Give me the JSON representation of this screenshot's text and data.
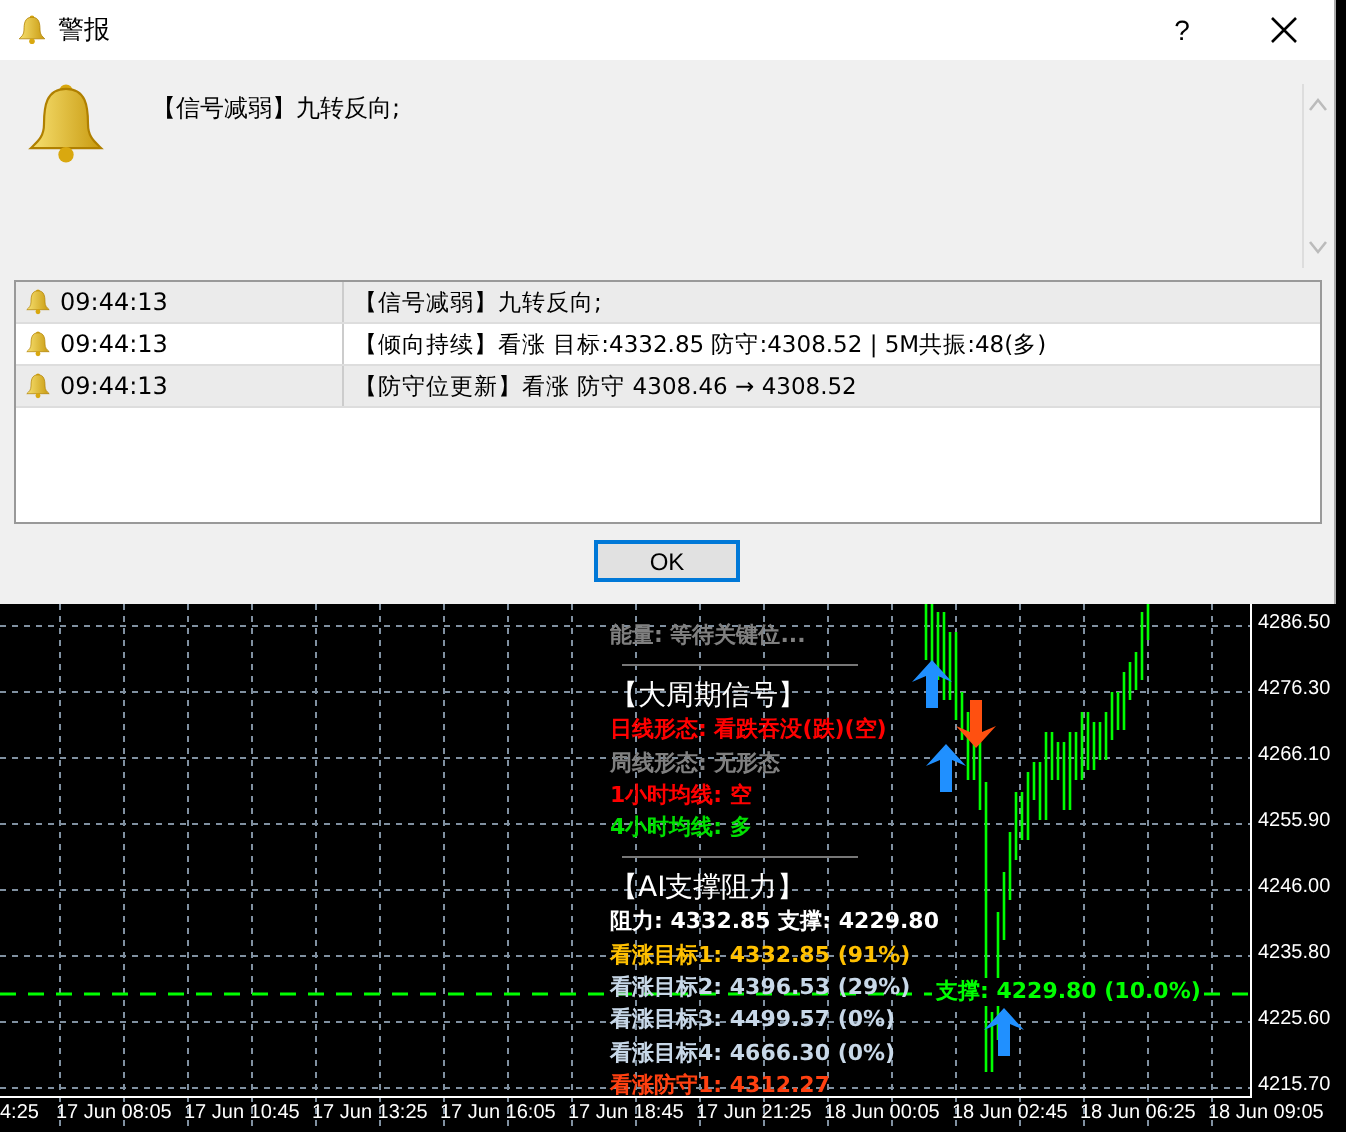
{
  "window": {
    "title": "警报",
    "help": "?"
  },
  "message": "【信号减弱】九转反向;",
  "alerts": [
    {
      "time": "09:44:13",
      "text": "【信号减弱】九转反向;"
    },
    {
      "time": "09:44:13",
      "text": "【倾向持续】看涨 目标:4332.85 防守:4308.52 | 5M共振:48(多)"
    },
    {
      "time": "09:44:13",
      "text": "【防守位更新】看涨 防守 4308.46 → 4308.52"
    }
  ],
  "ok_button": "OK",
  "chart": {
    "price_labels": [
      "4286.50",
      "4276.30",
      "4266.10",
      "4255.90",
      "4246.00",
      "4235.80",
      "4225.60",
      "4215.70"
    ],
    "time_labels": [
      "4:25",
      "17 Jun 08:05",
      "17 Jun 10:45",
      "17 Jun 13:25",
      "17 Jun 16:05",
      "17 Jun 18:45",
      "17 Jun 21:25",
      "18 Jun 00:05",
      "18 Jun 02:45",
      "18 Jun 06:25",
      "18 Jun 09:05"
    ],
    "overlay_lines": [
      {
        "kind": "line",
        "text": "能量: 等待关键位...",
        "color": "#808080"
      },
      {
        "kind": "divider"
      },
      {
        "kind": "heading",
        "text": "【大周期信号】",
        "color": "#ffffff"
      },
      {
        "kind": "line",
        "text": "日线形态: 看跌吞没(跌)(空)",
        "color": "#ff0000"
      },
      {
        "kind": "line",
        "text": "周线形态: 无形态",
        "color": "#808080"
      },
      {
        "kind": "line",
        "text": "1小时均线: 空",
        "color": "#ff0000"
      },
      {
        "kind": "line",
        "text": "4小时均线: 多",
        "color": "#00e000"
      },
      {
        "kind": "divider"
      },
      {
        "kind": "heading",
        "text": "【AI支撑阻力】",
        "color": "#ffffff"
      },
      {
        "kind": "line",
        "text": "阻力: 4332.85   支撑: 4229.80",
        "color": "#ffffff"
      },
      {
        "kind": "line",
        "text": "看涨目标1: 4332.85 (91%)",
        "color": "#ffc000"
      },
      {
        "kind": "line",
        "text": "看涨目标2: 4396.53 (29%)",
        "color": "#c8d8e8"
      },
      {
        "kind": "line",
        "text": "看涨目标3: 4499.57 (0%)",
        "color": "#c8d8e8"
      },
      {
        "kind": "line",
        "text": "看涨目标4: 4666.30 (0%)",
        "color": "#c8d8e8"
      },
      {
        "kind": "line",
        "text": "看涨防守1: 4312.27",
        "color": "#ff4010"
      }
    ],
    "support_label": "支撑: 4229.80 (10.0%)",
    "arrows": [
      {
        "kind": "up"
      },
      {
        "kind": "down"
      },
      {
        "kind": "up"
      },
      {
        "kind": "up"
      }
    ]
  }
}
